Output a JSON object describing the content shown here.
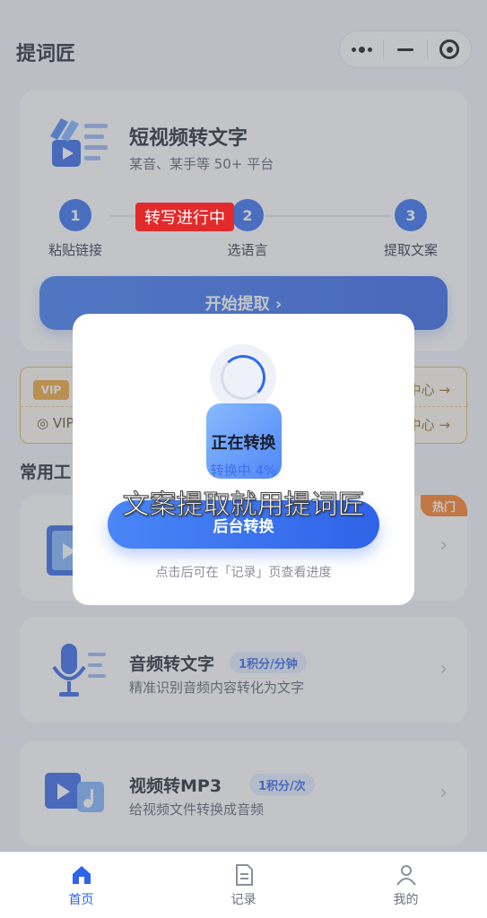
{
  "app": {
    "title": "提词匠"
  },
  "main_card": {
    "title": "短视频转文字",
    "subtitle": "某音、某手等 50+ 平台",
    "steps": [
      {
        "num": "1",
        "label": "粘贴链接"
      },
      {
        "num": "2",
        "label": "选语言"
      },
      {
        "num": "3",
        "label": "提取文案"
      }
    ],
    "start_button": "开始提取 ›"
  },
  "transcribing_tag": "转写进行中",
  "vip": {
    "badge": "VIP",
    "line2": "◎ VIP",
    "right1": "中心 →",
    "right2": "中心 →"
  },
  "section_title": "常用工",
  "tools": [
    {
      "badge": "热门"
    },
    {
      "title": "音频转文字",
      "pill": "1积分/分钟",
      "desc": "精准识别音频内容转化为文字"
    },
    {
      "title": "视频转MP3",
      "pill": "1积分/次",
      "desc": "给视频文件转换成音频"
    }
  ],
  "chevron": "›",
  "modal": {
    "title": "正在转换",
    "progress": "转换中 4%",
    "button": "后台转换",
    "hint": "点击后可在「记录」页查看进度"
  },
  "watermark": "文案提取就用提词匠",
  "tabs": [
    {
      "label": "首页",
      "active": true
    },
    {
      "label": "记录",
      "active": false
    },
    {
      "label": "我的",
      "active": false
    }
  ],
  "colors": {
    "accent": "#2f63e8",
    "hot": "#ff7a1a",
    "vip_border": "#e9b54a",
    "tag_red": "#e32a2a"
  }
}
